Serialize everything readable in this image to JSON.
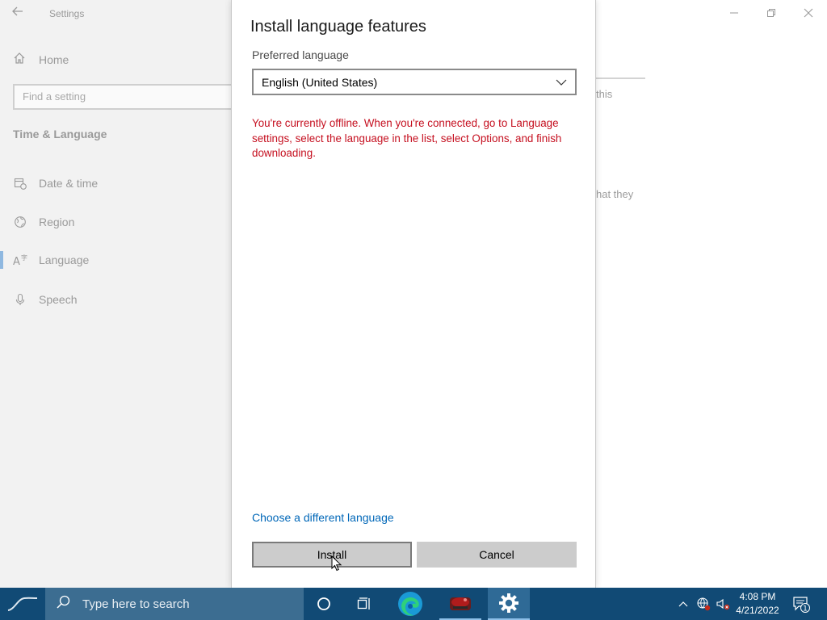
{
  "settings": {
    "app_title": "Settings",
    "home_label": "Home",
    "search_placeholder": "Find a setting",
    "section_title": "Time & Language",
    "nav": [
      {
        "label": "Date & time",
        "icon": "calendar-clock-icon"
      },
      {
        "label": "Region",
        "icon": "globe-icon"
      },
      {
        "label": "Language",
        "icon": "language-icon"
      },
      {
        "label": "Speech",
        "icon": "microphone-icon"
      }
    ],
    "active_nav": "Language",
    "right_fragment_1": "this",
    "right_fragment_2": "hat they"
  },
  "dialog": {
    "title": "Install language features",
    "preferred_label": "Preferred language",
    "selected_language": "English (United States)",
    "error_message": "You're currently offline. When you're connected, go to Language settings, select the language in the list, select Options, and finish downloading.",
    "link_label": "Choose a different language",
    "install_label": "Install",
    "cancel_label": "Cancel"
  },
  "taskbar": {
    "search_placeholder": "Type here to search",
    "time": "4:08 PM",
    "date": "4/21/2022",
    "notification_count": "1"
  },
  "colors": {
    "accent": "#0067b8",
    "error": "#c50f1f",
    "taskbar": "#114a75",
    "taskbar_search": "#3c6d91"
  }
}
